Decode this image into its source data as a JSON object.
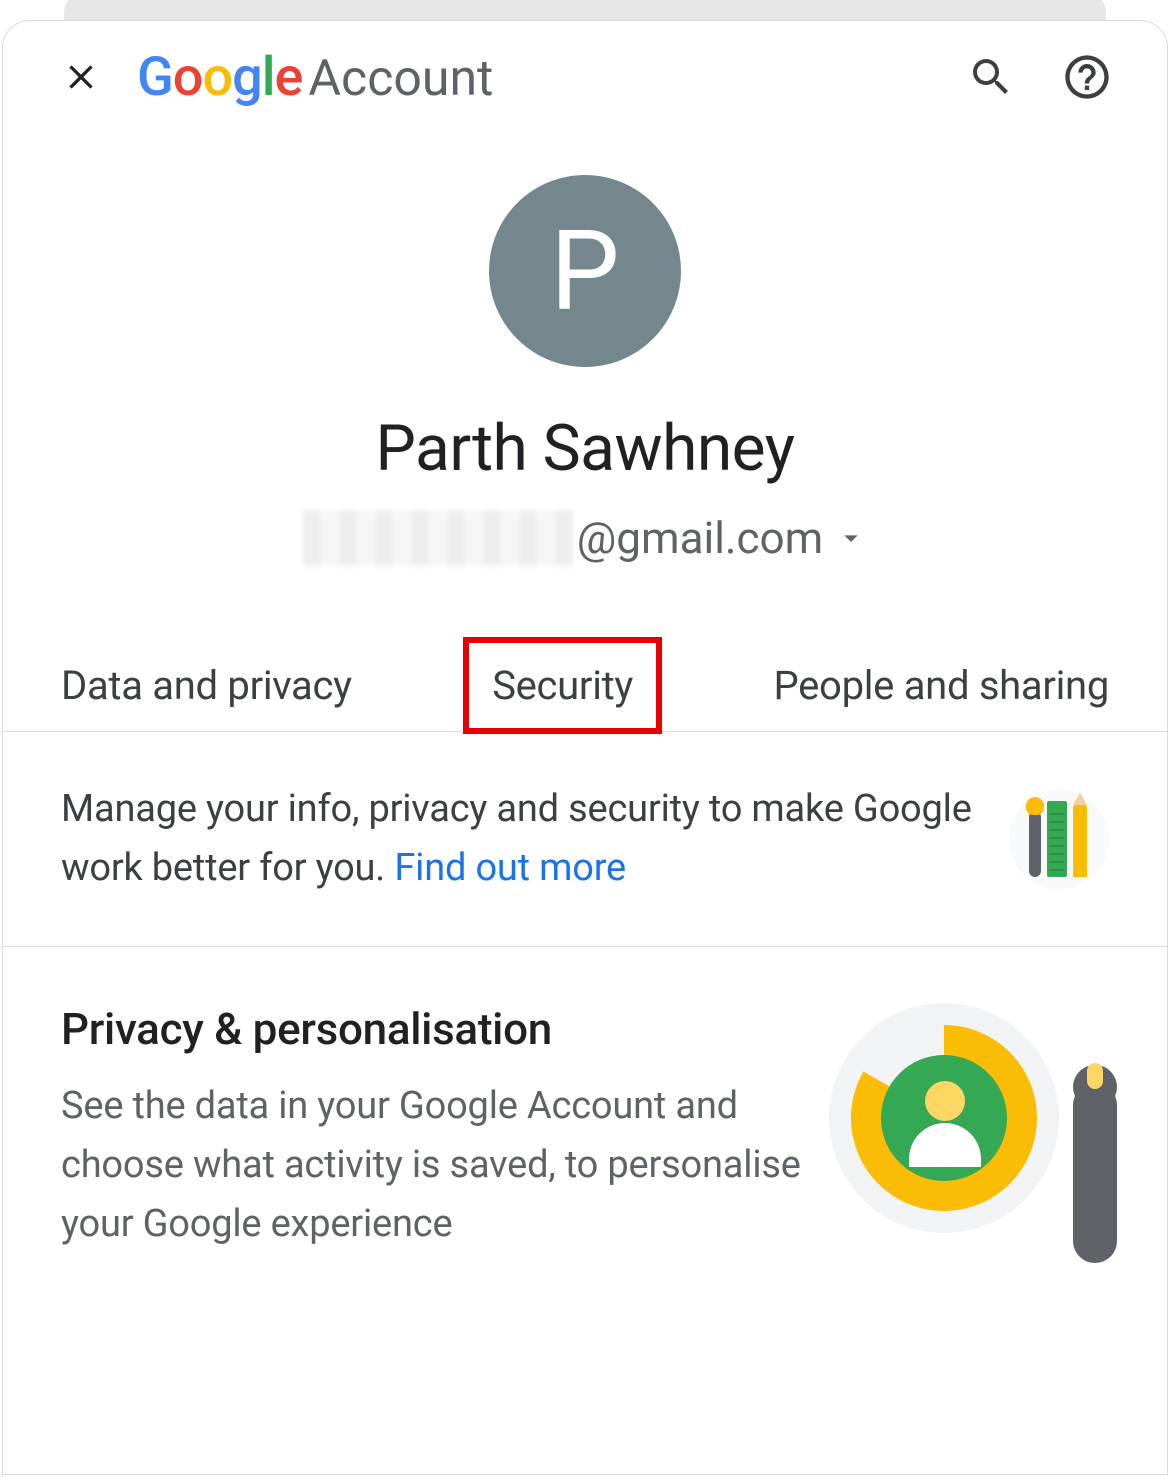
{
  "header": {
    "brand_word": "Account",
    "logo_letters": [
      "G",
      "o",
      "o",
      "g",
      "l",
      "e"
    ]
  },
  "profile": {
    "avatar_initial": "P",
    "display_name": "Parth Sawhney",
    "email_domain": "@gmail.com"
  },
  "tabs": [
    {
      "label": "Data and privacy"
    },
    {
      "label": "Security",
      "highlighted": true
    },
    {
      "label": "People and sharing"
    }
  ],
  "intro_card": {
    "text": "Manage your info, privacy and security to make Google work better for you. ",
    "link_text": "Find out more"
  },
  "privacy_section": {
    "title": "Privacy & personalisation",
    "body": "See the data in your Google Account and choose what activity is saved, to personalise your Google experience"
  }
}
